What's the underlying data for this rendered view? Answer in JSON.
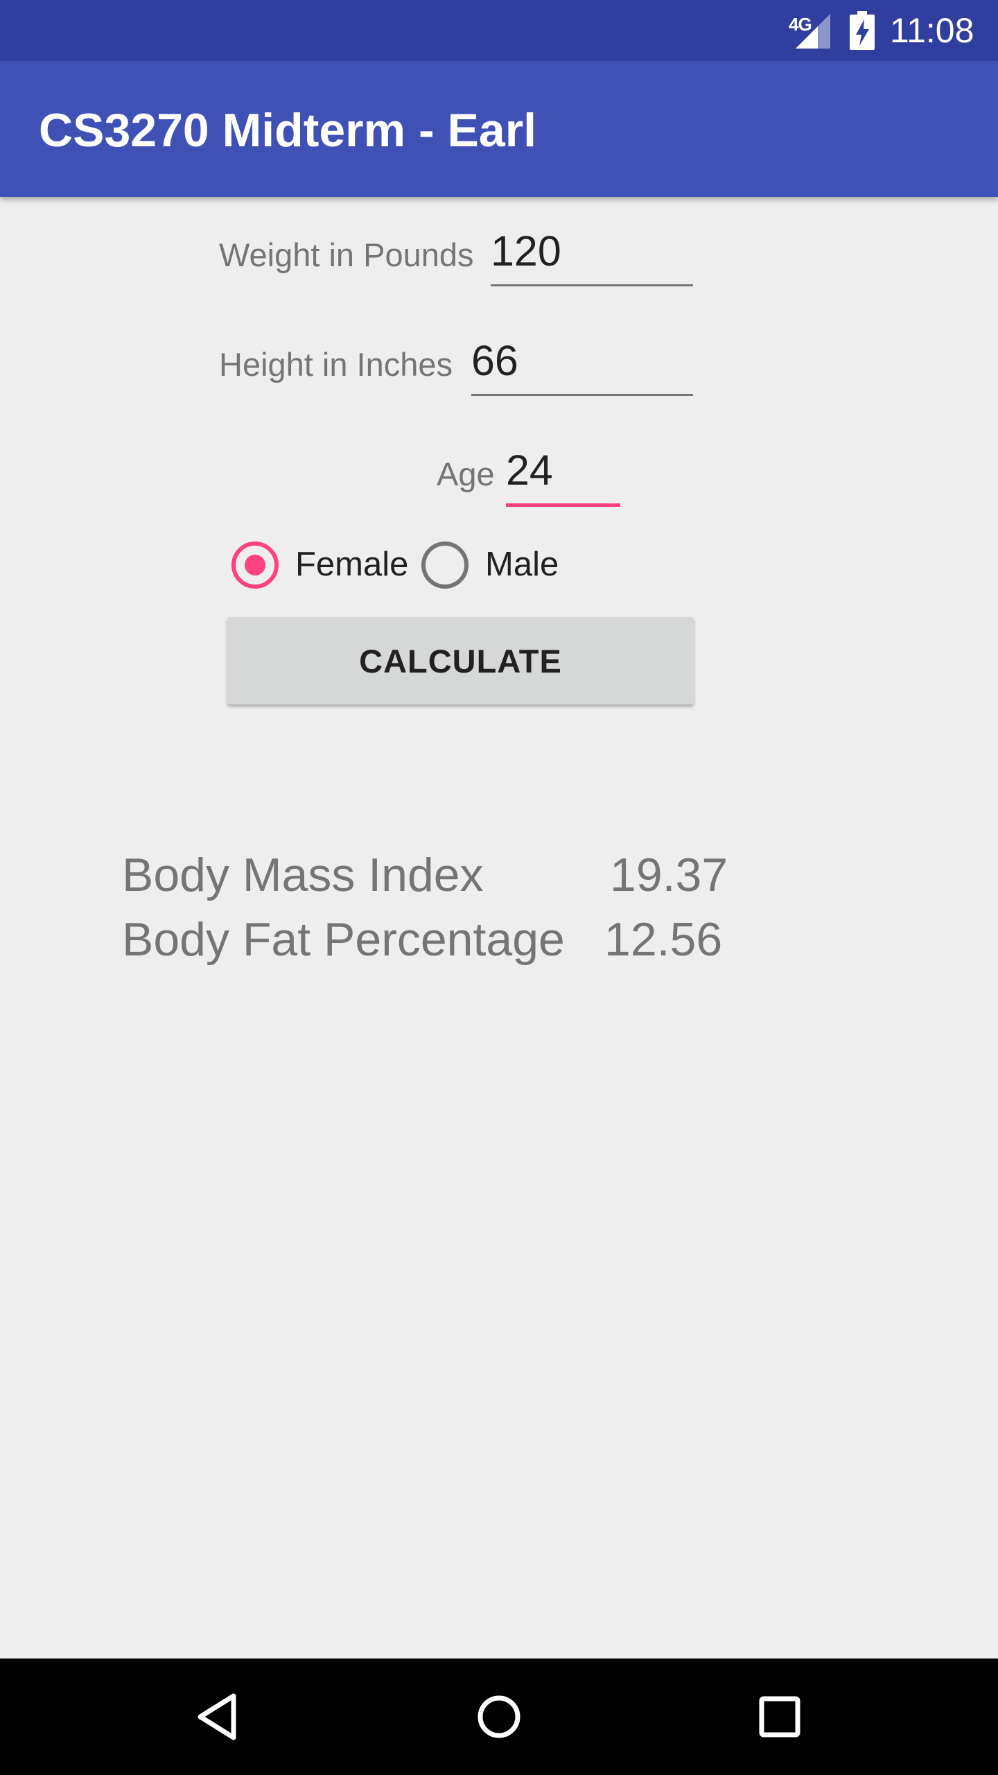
{
  "status_bar": {
    "network": "4G",
    "time": "11:08",
    "icons": [
      "signal-icon",
      "battery-charging-icon"
    ]
  },
  "app_bar": {
    "title": "CS3270 Midterm - Earl"
  },
  "form": {
    "weight": {
      "label": "Weight in Pounds",
      "value": "120"
    },
    "height": {
      "label": "Height in Inches",
      "value": "66"
    },
    "age": {
      "label": "Age",
      "value": "24"
    },
    "gender": {
      "options": [
        {
          "label": "Female",
          "checked": true
        },
        {
          "label": "Male",
          "checked": false
        }
      ]
    },
    "calculate_label": "CALCULATE"
  },
  "results": {
    "bmi": {
      "label": "Body Mass Index",
      "value": "19.37"
    },
    "body_fat": {
      "label": "Body Fat Percentage",
      "value": "12.56"
    }
  },
  "nav_bar": {
    "icons": [
      "back-icon",
      "home-icon",
      "recents-icon"
    ]
  },
  "colors": {
    "status_bar": "#303f9f",
    "app_bar": "#3f51b5",
    "accent": "#ff4081",
    "background": "#eeeeee"
  }
}
